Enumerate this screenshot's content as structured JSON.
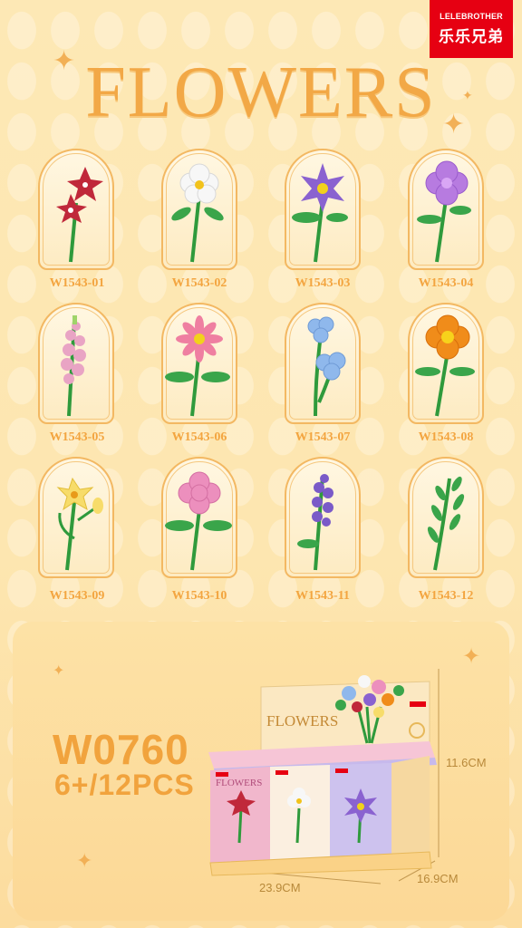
{
  "brand": {
    "name_en": "LELEBROTHER",
    "name_cn": "乐乐兄弟",
    "color": "#e60012"
  },
  "title": "FLOWERS",
  "products": [
    {
      "code": "W1543-01"
    },
    {
      "code": "W1543-02"
    },
    {
      "code": "W1543-03"
    },
    {
      "code": "W1543-04"
    },
    {
      "code": "W1543-05"
    },
    {
      "code": "W1543-06"
    },
    {
      "code": "W1543-07"
    },
    {
      "code": "W1543-08"
    },
    {
      "code": "W1543-09"
    },
    {
      "code": "W1543-10"
    },
    {
      "code": "W1543-11"
    },
    {
      "code": "W1543-12"
    }
  ],
  "package": {
    "model": "W0760",
    "age_count": "6+/12PCS",
    "height": "11.6CM",
    "width": "23.9CM",
    "depth": "16.9CM",
    "box_title": "FLOWERS",
    "box_label": "FLOWERS"
  },
  "colors": {
    "accent": "#f2a846",
    "background": "#fde9b8",
    "stem": "#2f9a3c"
  }
}
